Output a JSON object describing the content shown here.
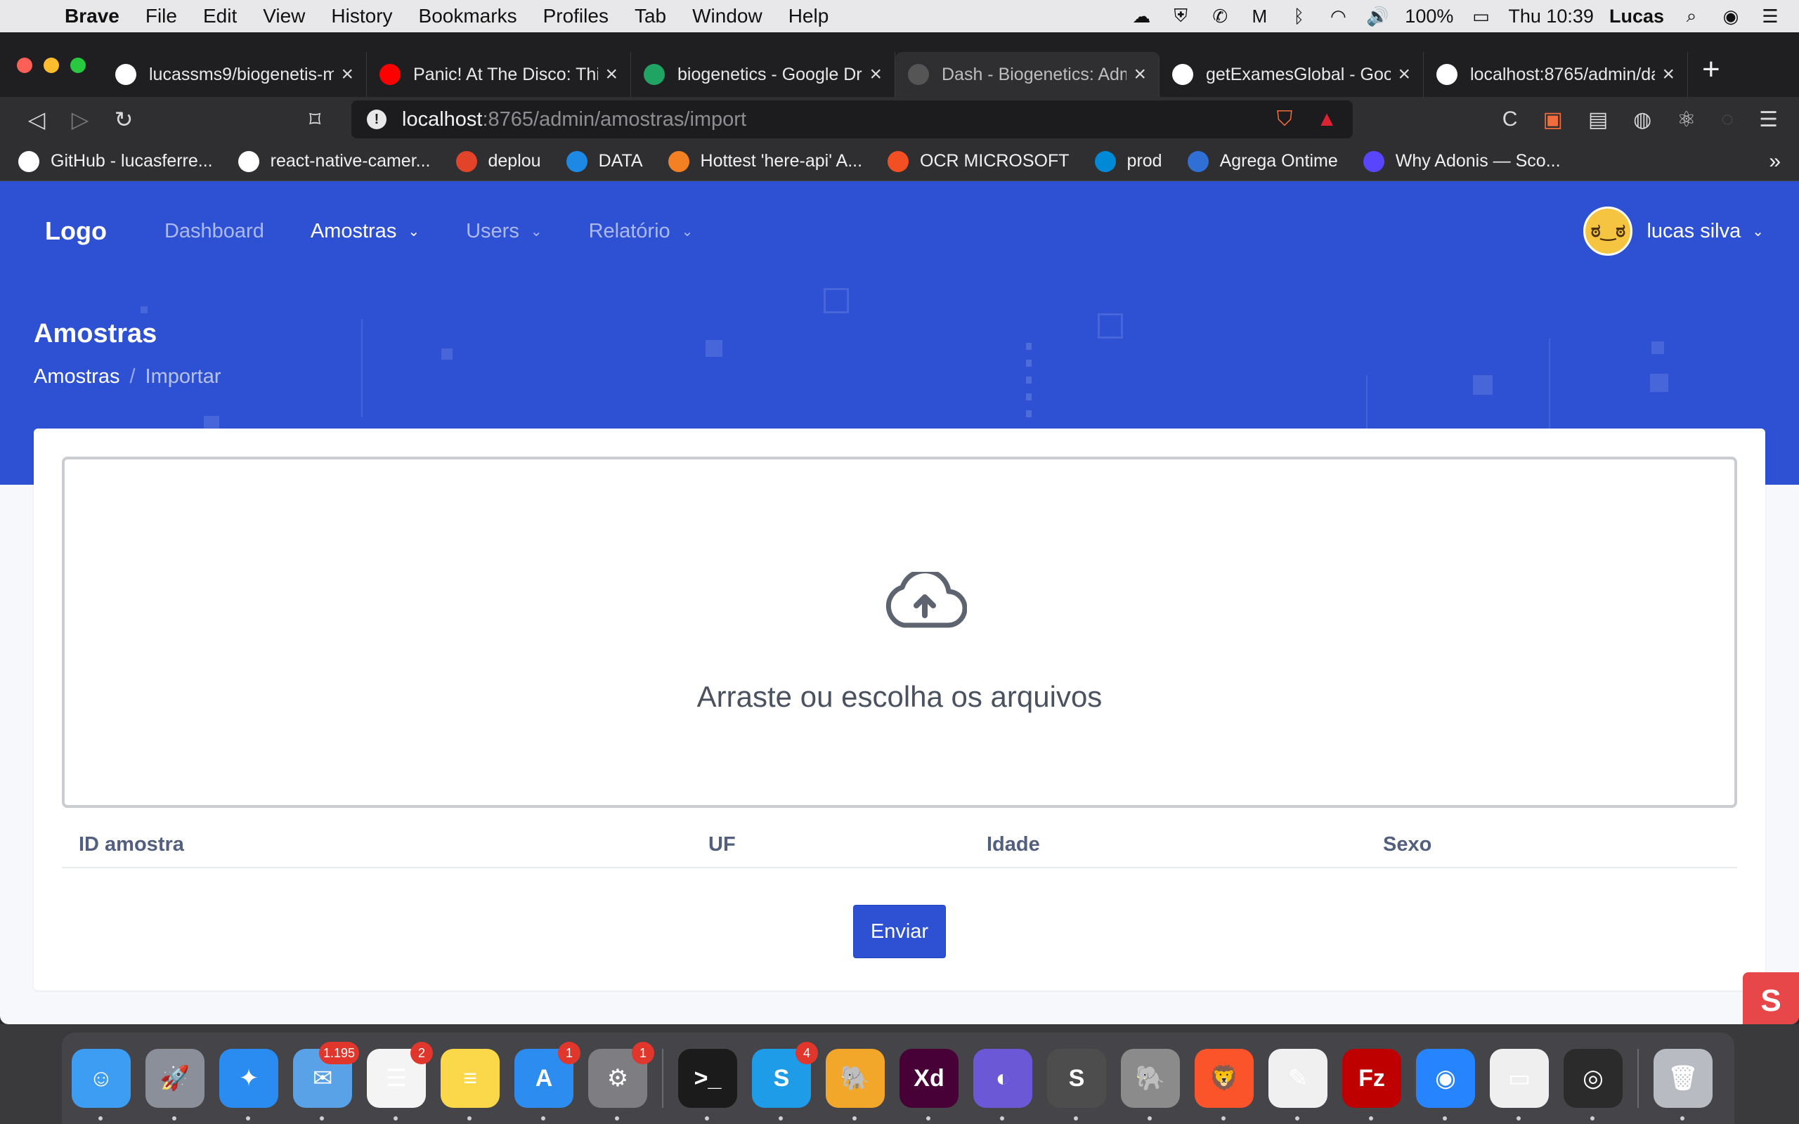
{
  "menubar": {
    "app": "Brave",
    "items": [
      "File",
      "Edit",
      "View",
      "History",
      "Bookmarks",
      "Profiles",
      "Tab",
      "Window",
      "Help"
    ],
    "battery": "100%",
    "clock": "Thu 10:39",
    "user": "Lucas"
  },
  "tabs": [
    {
      "title": "lucassms9/biogenetis-m",
      "icon": "github-icon",
      "color": "#ffffff"
    },
    {
      "title": "Panic! At The Disco: This",
      "icon": "youtube-icon",
      "color": "#ff0000"
    },
    {
      "title": "biogenetics - Google Dri",
      "icon": "google-drive-icon",
      "color": "#1fa463"
    },
    {
      "title": "Dash - Biogenetics: Adm",
      "icon": "globe-icon",
      "color": "#555555"
    },
    {
      "title": "getExamesGlobal - Goog",
      "icon": "google-icon",
      "color": "#ffffff"
    },
    {
      "title": "localhost:8765/admin/da",
      "icon": "globe-icon",
      "color": "#ffffff"
    }
  ],
  "address": {
    "host": "localhost",
    "path": ":8765/admin/amostras/import"
  },
  "bookmarks": [
    {
      "label": "GitHub - lucasferre...",
      "icon": "github-icon",
      "color": "#ffffff"
    },
    {
      "label": "react-native-camer...",
      "icon": "github-icon",
      "color": "#ffffff"
    },
    {
      "label": "deplou",
      "icon": "gitlab-icon",
      "color": "#e24329"
    },
    {
      "label": "DATA",
      "icon": "cube-icon",
      "color": "#1e88e5"
    },
    {
      "label": "Hottest 'here-api' A...",
      "icon": "stackoverflow-icon",
      "color": "#f48024"
    },
    {
      "label": "OCR MICROSOFT",
      "icon": "microsoft-icon",
      "color": "#f25022"
    },
    {
      "label": "prod",
      "icon": "azure-icon",
      "color": "#0089d6"
    },
    {
      "label": "Agrega Ontime",
      "icon": "azure-devops-icon",
      "color": "#2f6fd6"
    },
    {
      "label": "Why Adonis — Sco...",
      "icon": "adonis-icon",
      "color": "#5a45ff"
    }
  ],
  "nav": {
    "logo": "Logo",
    "links": [
      "Dashboard",
      "Amostras",
      "Users",
      "Relatório"
    ],
    "user_name": "lucas silva"
  },
  "header": {
    "title": "Amostras",
    "breadcrumb": {
      "root": "Amostras",
      "separator": "/",
      "current": "Importar"
    }
  },
  "upload": {
    "text": "Arraste ou escolha os arquivos"
  },
  "table": {
    "columns": [
      "ID amostra",
      "UF",
      "Idade",
      "Sexo"
    ]
  },
  "actions": {
    "submit": "Enviar"
  },
  "dock": {
    "apps": [
      {
        "name": "finder-icon",
        "color": "#3d9df3",
        "glyph": "☺"
      },
      {
        "name": "launchpad-icon",
        "color": "#8a8f99",
        "glyph": "🚀"
      },
      {
        "name": "safari-icon",
        "color": "#2a8cf0",
        "glyph": "✦"
      },
      {
        "name": "mail-icon",
        "color": "#5aa2e8",
        "glyph": "✉",
        "badge": "1.195"
      },
      {
        "name": "reminders-icon",
        "color": "#f4f4f4",
        "glyph": "☰",
        "badge": "2"
      },
      {
        "name": "notes-icon",
        "color": "#fbd74a",
        "glyph": "≡"
      },
      {
        "name": "app-store-icon",
        "color": "#2d8cf0",
        "glyph": "A",
        "badge": "1"
      },
      {
        "name": "system-preferences-icon",
        "color": "#7d7d82",
        "glyph": "⚙",
        "badge": "1"
      },
      {
        "name": "terminal-icon",
        "color": "#1b1b1b",
        "glyph": ">_"
      },
      {
        "name": "skype-icon",
        "color": "#1e9ce8",
        "glyph": "S",
        "badge": "4"
      },
      {
        "name": "tableplus-icon",
        "color": "#f2a62a",
        "glyph": "🐘"
      },
      {
        "name": "adobe-xd-icon",
        "color": "#470137",
        "glyph": "Xd"
      },
      {
        "name": "eclipse-icon",
        "color": "#6b58d6",
        "glyph": "◐"
      },
      {
        "name": "sublime-text-icon",
        "color": "#4d4d4d",
        "glyph": "S"
      },
      {
        "name": "tableplus-elephant-icon",
        "color": "#8b8b8b",
        "glyph": "🐘"
      },
      {
        "name": "brave-icon",
        "color": "#fb542b",
        "glyph": "🦁"
      },
      {
        "name": "textedit-icon",
        "color": "#f0f0f0",
        "glyph": "✎"
      },
      {
        "name": "filezilla-icon",
        "color": "#bf0000",
        "glyph": "Fz"
      },
      {
        "name": "sourcetree-icon",
        "color": "#2684ff",
        "glyph": "◉"
      },
      {
        "name": "preview-icon",
        "color": "#efefef",
        "glyph": "▭"
      },
      {
        "name": "creative-cloud-icon",
        "color": "#2b2b2b",
        "glyph": "◎"
      },
      {
        "name": "trash-icon",
        "color": "#b8bcc2",
        "glyph": "🗑"
      }
    ]
  }
}
